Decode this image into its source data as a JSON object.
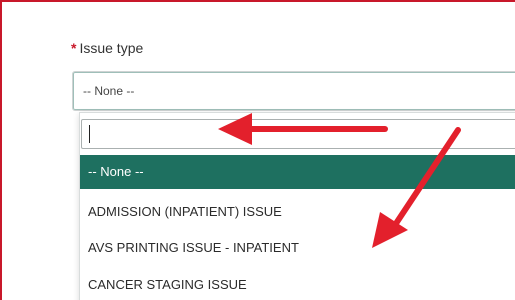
{
  "field": {
    "required_marker": "*",
    "label": "Issue type",
    "selected_value": "-- None --"
  },
  "dropdown": {
    "search_value": "",
    "options": [
      {
        "label": "-- None --",
        "selected": true
      },
      {
        "label": "ADMISSION (INPATIENT) ISSUE",
        "selected": false
      },
      {
        "label": "AVS PRINTING ISSUE - INPATIENT",
        "selected": false
      },
      {
        "label": "CANCER STAGING ISSUE",
        "selected": false
      }
    ]
  },
  "colors": {
    "selected_option_bg": "#1e7060",
    "required_marker": "#c8182a",
    "annotation_arrow": "#e3202c",
    "frame_border": "#c8182a"
  },
  "annotations": {
    "arrows": [
      {
        "icon": "left-arrow-icon",
        "points_to": "search-input"
      },
      {
        "icon": "down-left-arrow-icon",
        "points_to": "option-avs-printing-issue"
      }
    ]
  }
}
